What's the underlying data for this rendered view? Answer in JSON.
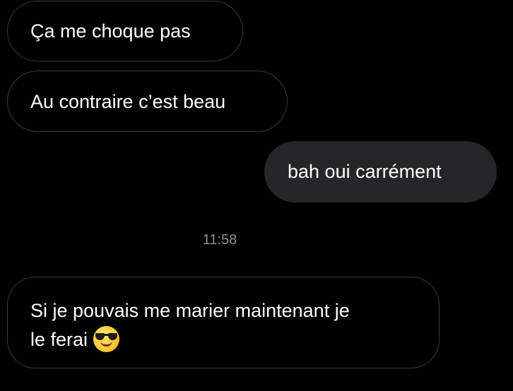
{
  "conversation": {
    "messages": [
      {
        "direction": "incoming",
        "text": "Ça me choque pas"
      },
      {
        "direction": "incoming",
        "text": "Au contraire c’est beau"
      },
      {
        "direction": "outgoing",
        "text": "bah oui carrément"
      }
    ],
    "timestamp": "11:58",
    "last_message": {
      "direction": "incoming",
      "line1": "Si je pouvais me marier maintenant je",
      "line2": "le ferai",
      "emoji": "smiling-face-with-sunglasses-icon"
    }
  },
  "colors": {
    "background": "#000000",
    "incoming_border": "#3a3a3c",
    "outgoing_bubble": "#262628",
    "text": "#ffffff",
    "timestamp": "#8e8e93"
  }
}
